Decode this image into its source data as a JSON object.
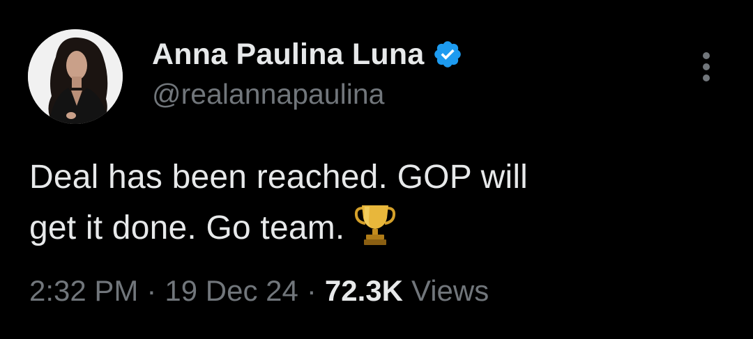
{
  "author": {
    "display_name": "Anna Paulina Luna",
    "handle": "@realannapaulina",
    "verified": true,
    "verified_color": "#1d9bf0",
    "avatar_icon": "profile-photo"
  },
  "tweet": {
    "text_line_1": "Deal has been reached. GOP will",
    "text_line_2": "get it done. Go team.",
    "emoji": "trophy-icon"
  },
  "meta": {
    "time": "2:32 PM",
    "separator": "·",
    "date": "19 Dec 24",
    "views_count": "72.3K",
    "views_label": "Views"
  },
  "colors": {
    "background": "#000000",
    "primary_text": "#e7e9ea",
    "secondary_text": "#71767b"
  },
  "menu": {
    "icon": "more-vertical-icon"
  }
}
